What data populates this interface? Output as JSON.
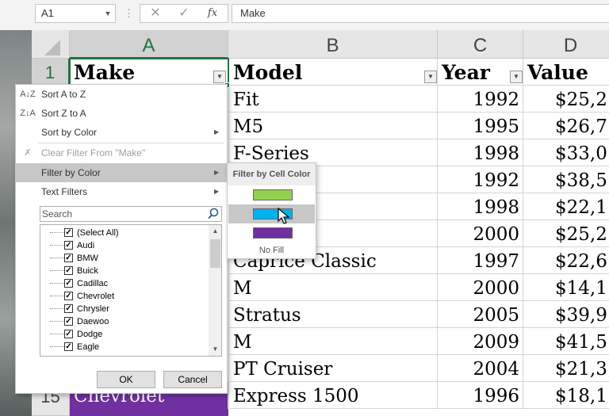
{
  "formula_bar": {
    "name_box": "A1",
    "formula": "Make",
    "fx_label": "fx"
  },
  "columns": [
    "A",
    "B",
    "C",
    "D"
  ],
  "rows": {
    "first": "1",
    "last": "15"
  },
  "headers": {
    "make": "Make",
    "model": "Model",
    "year": "Year",
    "value": "Value"
  },
  "data_rows": [
    {
      "model": "Fit",
      "year": "1992",
      "value": "$25,2"
    },
    {
      "model": "M5",
      "year": "1995",
      "value": "$26,7"
    },
    {
      "model": "F-Series",
      "year": "1998",
      "value": "$33,0"
    },
    {
      "model": "",
      "year": "1992",
      "value": "$38,5"
    },
    {
      "model": "",
      "year": "1998",
      "value": "$22,1"
    },
    {
      "model": "iser",
      "year": "2000",
      "value": "$25,2"
    },
    {
      "model": "Caprice Classic",
      "year": "1997",
      "value": "$22,6"
    },
    {
      "model": "M",
      "year": "2000",
      "value": "$14,1"
    },
    {
      "model": "Stratus",
      "year": "2005",
      "value": "$39,9"
    },
    {
      "model": "M",
      "year": "2009",
      "value": "$41,5"
    },
    {
      "model": "PT Cruiser",
      "year": "2004",
      "value": "$21,3"
    },
    {
      "model": "Express 1500",
      "year": "1996",
      "value": "$18,1"
    }
  ],
  "row15_make": "Chevrolet",
  "filter_menu": {
    "sort_az": "Sort A to Z",
    "sort_za": "Sort Z to A",
    "sort_by_color": "Sort by Color",
    "clear_filter": "Clear Filter From \"Make\"",
    "filter_by_color": "Filter by Color",
    "text_filters": "Text Filters",
    "search_placeholder": "Search",
    "items": [
      "(Select All)",
      "Audi",
      "BMW",
      "Buick",
      "Cadillac",
      "Chevrolet",
      "Chrysler",
      "Daewoo",
      "Dodge",
      "Eagle"
    ],
    "ok": "OK",
    "cancel": "Cancel"
  },
  "color_submenu": {
    "title": "Filter by Cell Color",
    "swatches": [
      "#92d050",
      "#00b0f0",
      "#7030a0"
    ],
    "no_fill": "No Fill"
  },
  "colors": {
    "accent": "#217346",
    "purple_fill": "#7030a0",
    "blue_fill": "#00b0f0"
  }
}
